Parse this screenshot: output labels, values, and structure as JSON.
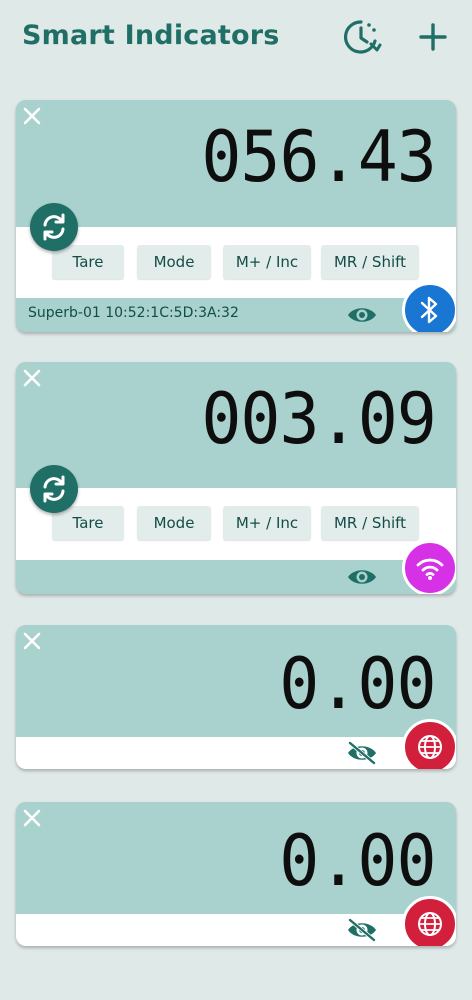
{
  "header": {
    "title": "Smart Indicators",
    "history_icon": "clock-history-icon",
    "add_icon": "plus-icon"
  },
  "colors": {
    "accent": "#1f6f66",
    "card": "#a9d1cd",
    "bluetooth": "#1976d2",
    "wifi": "#d631e6",
    "network": "#d21f3c"
  },
  "buttons": {
    "tare": "Tare",
    "mode": "Mode",
    "m_plus": "M+ / Inc",
    "mr": "MR / Shift"
  },
  "cards": [
    {
      "reading": "056.43",
      "device": "Superb-01 10:52:1C:5D:3A:32",
      "connection": "bluetooth-icon",
      "visible": true
    },
    {
      "reading": "003.09",
      "device": "",
      "connection": "wifi-icon",
      "visible": true
    },
    {
      "reading": "0.00",
      "connection": "globe-icon",
      "visible": false
    },
    {
      "reading": "0.00",
      "connection": "globe-icon",
      "visible": false
    }
  ]
}
